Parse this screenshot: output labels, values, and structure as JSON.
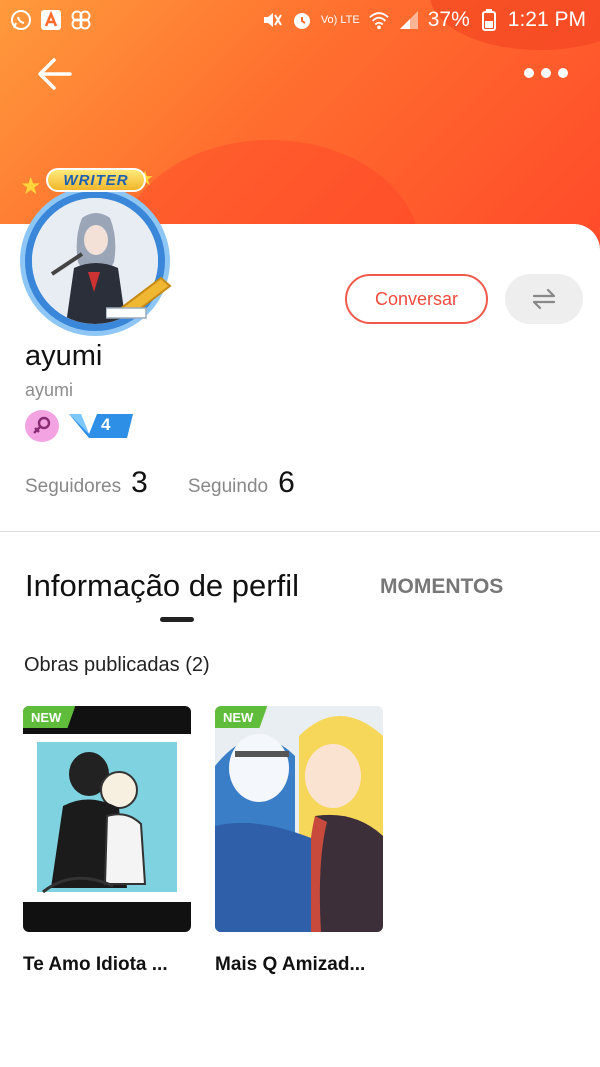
{
  "status_bar": {
    "battery": "37%",
    "time": "1:21 PM",
    "network": "Vo) LTE"
  },
  "profile": {
    "avatar_badge": "WRITER",
    "name": "ayumi",
    "handle": "ayumi",
    "level": "4",
    "followers_label": "Seguidores",
    "followers_count": "3",
    "following_label": "Seguindo",
    "following_count": "6"
  },
  "actions": {
    "chat_label": "Conversar"
  },
  "tabs": [
    {
      "label": "Informação de perfil",
      "active": true
    },
    {
      "label": "MOMENTOS",
      "active": false
    }
  ],
  "works": {
    "title": "Obras publicadas (2)",
    "items": [
      {
        "tag": "NEW",
        "title": "Te Amo Idiota ..."
      },
      {
        "tag": "NEW",
        "title": "Mais Q Amizad..."
      }
    ]
  },
  "colors": {
    "accent": "#ef4a3c",
    "header_start": "#ff9a3c",
    "header_end": "#ff4a2a",
    "new_tag": "#5fbd3b",
    "level_badge": "#2d8fe6"
  }
}
